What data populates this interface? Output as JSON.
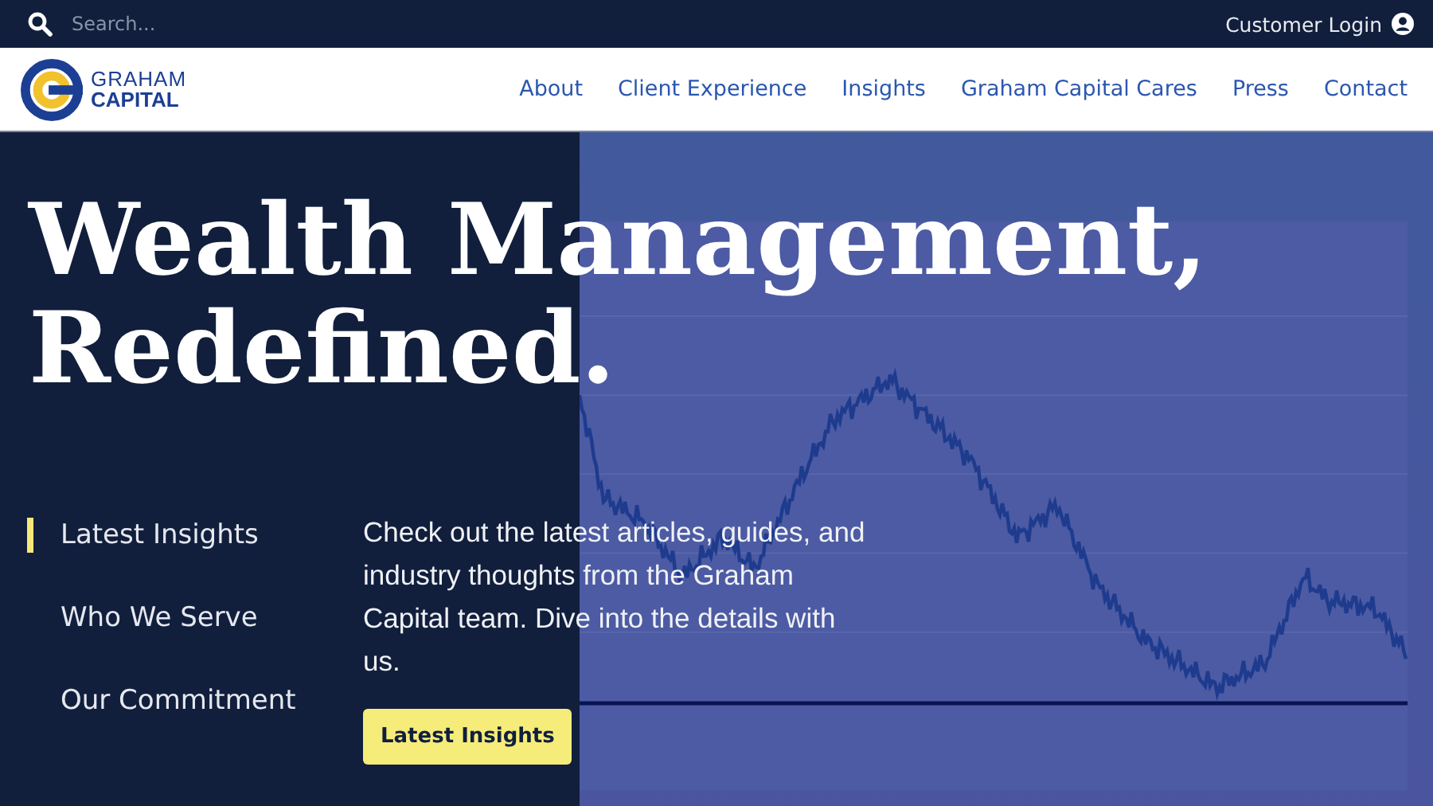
{
  "top_bar": {
    "search": {
      "placeholder": "Search..."
    },
    "login": "Customer Login"
  },
  "header": {
    "logo": {
      "line1": "GRAHAM",
      "line2": "CAPITAL"
    },
    "nav": [
      "About",
      "Client Experience",
      "Insights",
      "Graham Capital Cares",
      "Press",
      "Contact"
    ]
  },
  "hero": {
    "headline": [
      "Wealth Management,",
      "Redefined."
    ],
    "tabs": [
      {
        "label": "Latest Insights",
        "selected": true
      },
      {
        "label": "Who We Serve",
        "selected": false
      },
      {
        "label": "Our Commitment",
        "selected": false
      }
    ],
    "text": "Check out the latest articles, guides, and industry thoughts from the Graham Capital team. Dive into the details with us.",
    "button": "Latest Insights"
  }
}
